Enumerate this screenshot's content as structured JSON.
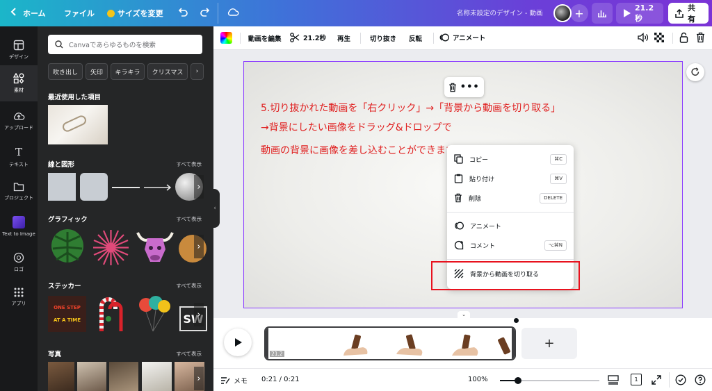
{
  "topbar": {
    "home": "ホーム",
    "file": "ファイル",
    "resize": "サイズを変更",
    "doc_title": "名称未設定のデザイン - 動画",
    "duration": "21.2秒",
    "share": "共有"
  },
  "rail": {
    "items": [
      {
        "label": "デザイン",
        "icon": "layout-icon"
      },
      {
        "label": "素材",
        "icon": "elements-icon"
      },
      {
        "label": "アップロード",
        "icon": "upload-icon"
      },
      {
        "label": "テキスト",
        "icon": "text-icon"
      },
      {
        "label": "プロジェクト",
        "icon": "folder-icon"
      },
      {
        "label": "Text to Image",
        "icon": "text-to-image-icon"
      },
      {
        "label": "ロゴ",
        "icon": "logo-icon"
      },
      {
        "label": "アプリ",
        "icon": "apps-icon"
      }
    ]
  },
  "panel": {
    "search_placeholder": "Canvaであらゆるものを検索",
    "chips": [
      "吹き出し",
      "矢印",
      "キラキラ",
      "クリスマス"
    ],
    "recent_title": "最近使用した項目",
    "lines_title": "線と図形",
    "graphics_title": "グラフィック",
    "stickers_title": "ステッカー",
    "photos_title": "写真",
    "see_all": "すべて表示",
    "sticker_text": [
      "ONE STEP",
      "AT A TIME"
    ],
    "sticker_letters": "SW"
  },
  "toolbar": {
    "edit_video": "動画を編集",
    "duration": "21.2秒",
    "play": "再生",
    "crop": "切り抜き",
    "flip": "反転",
    "animate": "アニメート"
  },
  "canvas": {
    "lines": [
      "5.切り抜かれた動画を「右クリック」→「背景から動画を切り取る」",
      "→背景にしたい画像をドラッグ&ドロップで",
      "動画の背景に画像を差し込むことができます！"
    ]
  },
  "context_menu": {
    "items": [
      {
        "label": "コピー",
        "shortcut": "⌘C",
        "icon": "copy-icon"
      },
      {
        "label": "貼り付け",
        "shortcut": "⌘V",
        "icon": "paste-icon"
      },
      {
        "label": "削除",
        "shortcut": "DELETE",
        "icon": "trash-icon"
      },
      {
        "label": "アニメート",
        "shortcut": "",
        "icon": "animate-icon"
      },
      {
        "label": "コメント",
        "shortcut": "⌥⌘N",
        "icon": "comment-icon"
      },
      {
        "label": "背景から動画を切り取る",
        "shortcut": "",
        "icon": "bg-remove-icon"
      }
    ]
  },
  "timeline": {
    "clip_duration": "21.2"
  },
  "bottombar": {
    "notes": "メモ",
    "time": "0:21 / 0:21",
    "zoom": "100%",
    "zoom_fraction": 0.18,
    "page_count": "1"
  },
  "colors": {
    "accent": "#8b3dff",
    "annotation": "#e02020",
    "highlight": "#e8121e"
  }
}
